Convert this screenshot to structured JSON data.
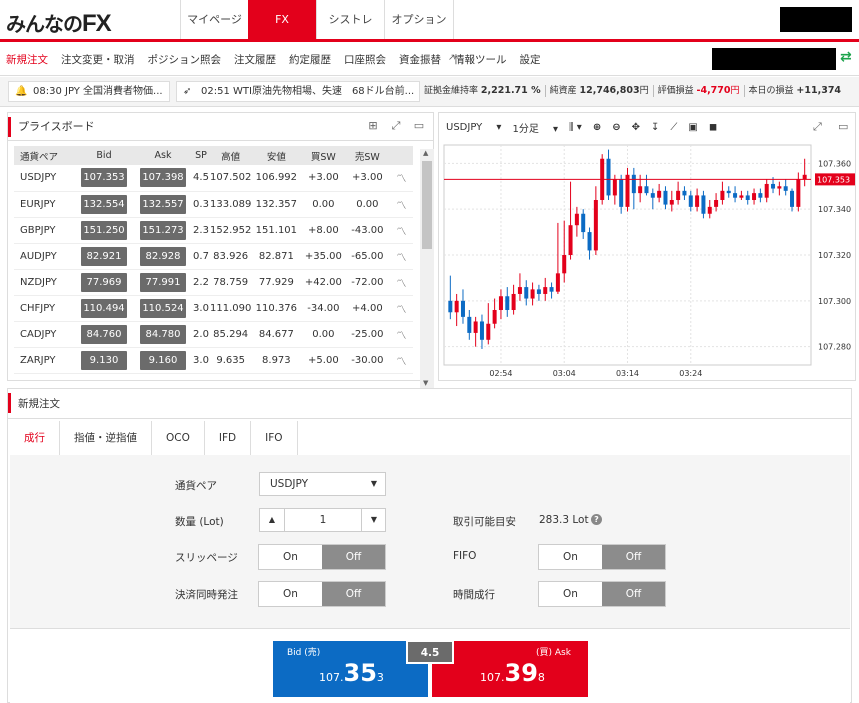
{
  "header": {
    "logo_prefix": "みんなの",
    "logo_fx": "FX",
    "tabs": [
      {
        "label": "マイページ",
        "active": false
      },
      {
        "label": "FX",
        "active": true
      },
      {
        "label": "シストレ",
        "active": false
      },
      {
        "label": "オプション",
        "active": false
      }
    ]
  },
  "menu": {
    "items": [
      {
        "label": "新規注文",
        "active": true
      },
      {
        "label": "注文変更・取消",
        "active": false
      },
      {
        "label": "ポジション照会",
        "active": false
      },
      {
        "label": "注文履歴",
        "active": false
      },
      {
        "label": "約定履歴",
        "active": false
      },
      {
        "label": "口座照会",
        "active": false
      },
      {
        "label": "資金振替",
        "active": false
      },
      {
        "label": "情報ツール",
        "active": false
      },
      {
        "label": "設定",
        "active": false
      }
    ]
  },
  "news": {
    "item1": "08:30 JPY 全国消費者物価...",
    "item2": "02:51 WTI原油先物相場、失速　68ドル台前..."
  },
  "account": {
    "margin_ratio_label": "証拠金維持率",
    "margin_ratio_value": "2,221.71 %",
    "net_assets_label": "純資産",
    "net_assets_value": "12,746,803",
    "eval_pl_label": "評価損益",
    "eval_pl_value": "-4,770",
    "today_pl_label": "本日の損益",
    "today_pl_value": "+11,374",
    "yen": "円"
  },
  "priceboard": {
    "title": "プライスボード",
    "headers": [
      "通貨ペア",
      "Bid",
      "Ask",
      "SP",
      "高値",
      "安値",
      "買SW",
      "売SW"
    ],
    "rows": [
      {
        "pair": "USDJPY",
        "bid": "107.353",
        "ask": "107.398",
        "sp": "4.5",
        "high": "107.502",
        "low": "106.992",
        "buy_sw": "+3.00",
        "sell_sw": "+3.00",
        "buy_neg": false,
        "sell_neg": false
      },
      {
        "pair": "EURJPY",
        "bid": "132.554",
        "ask": "132.557",
        "sp": "0.3",
        "high": "133.089",
        "low": "132.357",
        "buy_sw": "0.00",
        "sell_sw": "0.00",
        "buy_neg": false,
        "sell_neg": false
      },
      {
        "pair": "GBPJPY",
        "bid": "151.250",
        "ask": "151.273",
        "sp": "2.3",
        "high": "152.952",
        "low": "151.101",
        "buy_sw": "+8.00",
        "sell_sw": "-43.00",
        "buy_neg": false,
        "sell_neg": true
      },
      {
        "pair": "AUDJPY",
        "bid": "82.921",
        "ask": "82.928",
        "sp": "0.7",
        "high": "83.926",
        "low": "82.871",
        "buy_sw": "+35.00",
        "sell_sw": "-65.00",
        "buy_neg": false,
        "sell_neg": true
      },
      {
        "pair": "NZDJPY",
        "bid": "77.969",
        "ask": "77.991",
        "sp": "2.2",
        "high": "78.759",
        "low": "77.929",
        "buy_sw": "+42.00",
        "sell_sw": "-72.00",
        "buy_neg": false,
        "sell_neg": true
      },
      {
        "pair": "CHFJPY",
        "bid": "110.494",
        "ask": "110.524",
        "sp": "3.0",
        "high": "111.090",
        "low": "110.376",
        "buy_sw": "-34.00",
        "sell_sw": "+4.00",
        "buy_neg": true,
        "sell_neg": false
      },
      {
        "pair": "CADJPY",
        "bid": "84.760",
        "ask": "84.780",
        "sp": "2.0",
        "high": "85.294",
        "low": "84.677",
        "buy_sw": "0.00",
        "sell_sw": "-25.00",
        "buy_neg": false,
        "sell_neg": true
      },
      {
        "pair": "ZARJPY",
        "bid": "9.130",
        "ask": "9.160",
        "sp": "3.0",
        "high": "9.635",
        "low": "8.973",
        "buy_sw": "+5.00",
        "sell_sw": "-30.00",
        "buy_neg": false,
        "sell_neg": true
      }
    ]
  },
  "chart_toolbar": {
    "pair": "USDJPY",
    "timeframe": "1分足"
  },
  "chart_data": {
    "type": "candlestick",
    "symbol": "USDJPY",
    "timeframe": "1分足",
    "x_ticks": [
      "02:54",
      "03:04",
      "03:14",
      "03:24"
    ],
    "y_ticks": [
      107.28,
      107.3,
      107.32,
      107.34,
      107.36
    ],
    "ylim": [
      107.272,
      107.368
    ],
    "current_price": 107.353,
    "current_price_label": "107.353",
    "up_color": "#e3001b",
    "down_color": "#0c6bc4",
    "grid": true,
    "candles": [
      [
        107.3,
        107.295,
        107.311,
        107.292
      ],
      [
        107.295,
        107.3,
        107.303,
        107.289
      ],
      [
        107.3,
        107.293,
        107.305,
        107.29
      ],
      [
        107.293,
        107.286,
        107.296,
        107.283
      ],
      [
        107.286,
        107.291,
        107.293,
        107.28
      ],
      [
        107.291,
        107.283,
        107.294,
        107.279
      ],
      [
        107.283,
        107.29,
        107.299,
        107.281
      ],
      [
        107.29,
        107.296,
        107.301,
        107.288
      ],
      [
        107.296,
        107.302,
        107.305,
        107.292
      ],
      [
        107.302,
        107.296,
        107.306,
        107.293
      ],
      [
        107.296,
        107.303,
        107.307,
        107.294
      ],
      [
        107.303,
        107.306,
        107.312,
        107.3
      ],
      [
        107.306,
        107.301,
        107.309,
        107.298
      ],
      [
        107.301,
        107.305,
        107.308,
        107.298
      ],
      [
        107.305,
        107.303,
        107.307,
        107.3
      ],
      [
        107.303,
        107.306,
        107.31,
        107.3
      ],
      [
        107.306,
        107.304,
        107.308,
        107.301
      ],
      [
        107.304,
        107.312,
        107.334,
        107.303
      ],
      [
        107.312,
        107.32,
        107.335,
        107.308
      ],
      [
        107.32,
        107.333,
        107.352,
        107.318
      ],
      [
        107.333,
        107.338,
        107.341,
        107.328
      ],
      [
        107.338,
        107.33,
        107.34,
        107.327
      ],
      [
        107.33,
        107.322,
        107.332,
        107.318
      ],
      [
        107.322,
        107.344,
        107.35,
        107.32
      ],
      [
        107.344,
        107.362,
        107.364,
        107.342
      ],
      [
        107.362,
        107.346,
        107.366,
        107.344
      ],
      [
        107.346,
        107.353,
        107.355,
        107.342
      ],
      [
        107.353,
        107.341,
        107.355,
        107.338
      ],
      [
        107.341,
        107.355,
        107.358,
        107.339
      ],
      [
        107.355,
        107.347,
        107.358,
        107.34
      ],
      [
        107.347,
        107.35,
        107.355,
        107.343
      ],
      [
        107.35,
        107.347,
        107.355,
        107.346
      ],
      [
        107.347,
        107.345,
        107.349,
        107.34
      ],
      [
        107.345,
        107.348,
        107.351,
        107.343
      ],
      [
        107.348,
        107.342,
        107.35,
        107.34
      ],
      [
        107.342,
        107.344,
        107.348,
        107.339
      ],
      [
        107.344,
        107.348,
        107.352,
        107.342
      ],
      [
        107.348,
        107.346,
        107.35,
        107.344
      ],
      [
        107.346,
        107.341,
        107.348,
        107.339
      ],
      [
        107.341,
        107.346,
        107.349,
        107.339
      ],
      [
        107.346,
        107.338,
        107.348,
        107.336
      ],
      [
        107.338,
        107.341,
        107.344,
        107.336
      ],
      [
        107.341,
        107.344,
        107.347,
        107.339
      ],
      [
        107.344,
        107.348,
        107.352,
        107.342
      ],
      [
        107.348,
        107.347,
        107.35,
        107.345
      ],
      [
        107.347,
        107.345,
        107.35,
        107.343
      ],
      [
        107.345,
        107.346,
        107.348,
        107.344
      ],
      [
        107.346,
        107.344,
        107.348,
        107.342
      ],
      [
        107.344,
        107.347,
        107.349,
        107.342
      ],
      [
        107.347,
        107.345,
        107.349,
        107.343
      ],
      [
        107.345,
        107.351,
        107.353,
        107.343
      ],
      [
        107.351,
        107.349,
        107.354,
        107.347
      ],
      [
        107.349,
        107.35,
        107.352,
        107.346
      ],
      [
        107.35,
        107.348,
        107.353,
        107.346
      ],
      [
        107.348,
        107.341,
        107.349,
        107.339
      ],
      [
        107.341,
        107.353,
        107.356,
        107.339
      ],
      [
        107.353,
        107.355,
        107.362,
        107.35
      ]
    ]
  },
  "order": {
    "section_title": "新規注文",
    "tabs": [
      {
        "label": "成行",
        "active": true
      },
      {
        "label": "指値・逆指値",
        "active": false
      },
      {
        "label": "OCO",
        "active": false
      },
      {
        "label": "IFD",
        "active": false
      },
      {
        "label": "IFO",
        "active": false
      }
    ],
    "pair_label": "通貨ペア",
    "pair_value": "USDJPY",
    "qty_label": "数量 (Lot)",
    "qty_value": "1",
    "tradable_label": "取引可能目安",
    "tradable_value": "283.3 Lot",
    "slippage_label": "スリッページ",
    "fifo_label": "FIFO",
    "settle_label": "決済同時発注",
    "time_label": "時間成行",
    "on_label": "On",
    "off_label": "Off",
    "spread": "4.5",
    "bid_label": "Bid (売)",
    "ask_label": "(買) Ask",
    "bid_prefix": "107.",
    "bid_big": "35",
    "bid_suffix": "3",
    "ask_prefix": "107.",
    "ask_big": "39",
    "ask_suffix": "8"
  }
}
